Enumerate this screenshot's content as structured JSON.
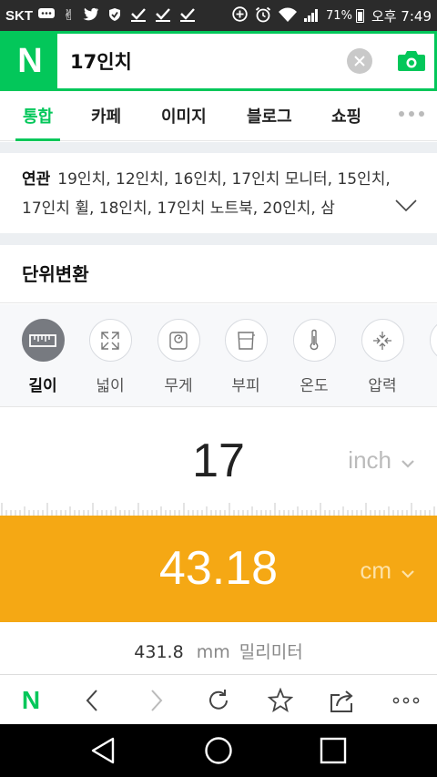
{
  "status_bar": {
    "carrier": "SKT",
    "battery": "71%",
    "time": "오후 7:49",
    "icons": [
      "message-icon",
      "victory-hand-icon",
      "twitter-icon",
      "shield-icon",
      "check-icon",
      "check-icon",
      "check-icon",
      "add-circle-icon",
      "alarm-icon",
      "wifi-icon",
      "signal-icon",
      "battery-icon"
    ]
  },
  "search": {
    "logo": "N",
    "query": "17인치",
    "clear_icon": "close-icon",
    "camera_icon": "camera-icon"
  },
  "tabs": [
    {
      "label": "통합",
      "active": true
    },
    {
      "label": "카페"
    },
    {
      "label": "이미지"
    },
    {
      "label": "블로그"
    },
    {
      "label": "쇼핑"
    }
  ],
  "related": {
    "label": "연관",
    "terms": "19인치, 12인치, 16인치, 17인치 모니터, 15인치, 17인치 휠, 18인치, 17인치 노트북, 20인치, 삼"
  },
  "unit_converter": {
    "title": "단위변환",
    "categories": [
      {
        "label": "길이",
        "icon": "ruler-icon",
        "active": true
      },
      {
        "label": "넓이",
        "icon": "expand-arrows-icon"
      },
      {
        "label": "무게",
        "icon": "scale-icon"
      },
      {
        "label": "부피",
        "icon": "beaker-icon"
      },
      {
        "label": "온도",
        "icon": "thermometer-icon"
      },
      {
        "label": "압력",
        "icon": "pressure-icon"
      }
    ],
    "input": {
      "value": "17",
      "unit": "inch"
    },
    "output": {
      "value": "43.18",
      "unit": "cm"
    },
    "secondary": {
      "value": "431.8",
      "unit": "mm",
      "unit_name": "밀리미터"
    },
    "colors": {
      "output_bg": "#f5a814",
      "brand": "#03c75a"
    }
  },
  "browser_bar": {
    "buttons": [
      "naver-home-icon",
      "back-icon",
      "forward-icon",
      "refresh-icon",
      "bookmark-star-icon",
      "share-icon",
      "more-icon"
    ]
  },
  "nav_bar": {
    "buttons": [
      "back-triangle-icon",
      "home-circle-icon",
      "recents-square-icon"
    ]
  }
}
